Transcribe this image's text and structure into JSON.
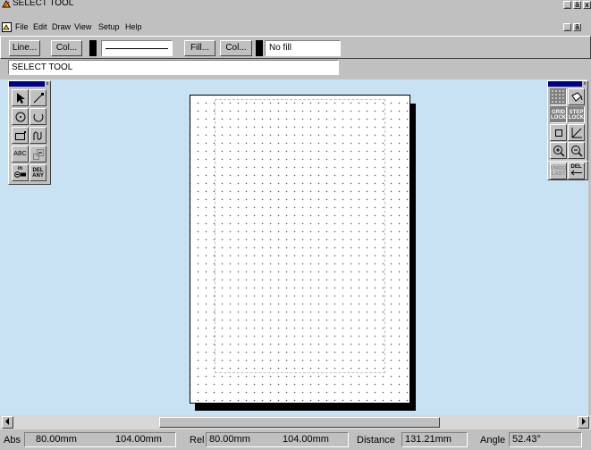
{
  "window": {
    "title": "SELECT TOOL",
    "minimize": "_",
    "restore": "ā",
    "close": "x"
  },
  "menu": {
    "items": [
      "File",
      "Edit",
      "Draw",
      "View",
      "Setup",
      "Help"
    ],
    "mdi_minimize": "_",
    "mdi_restore": "ā"
  },
  "toolbar": {
    "line_label": "Line...",
    "line_col_label": "Col...",
    "fill_label": "Fill...",
    "fill_col_label": "Col...",
    "fill_value": "No fill"
  },
  "status_field": "SELECT TOOL",
  "left_palette": {
    "close": "x",
    "text_tool": "ABC",
    "in_label": "in",
    "del_any_1": "DEL",
    "del_any_2": "ANY"
  },
  "right_palette": {
    "close": "x",
    "grid_lock_1": "GRID",
    "grid_lock_2": "LOCK",
    "step_lock_1": "STEP",
    "step_lock_2": "LOCK",
    "undo_1": "UNDO",
    "undo_2": "LAST",
    "del_label": "DEL"
  },
  "statusbar": {
    "abs_label": "Abs",
    "abs_x": "80.00mm",
    "abs_y": "104.00mm",
    "rel_label": "Rel",
    "rel_x": "80.00mm",
    "rel_y": "104.00mm",
    "distance_label": "Distance",
    "distance_value": "131.21mm",
    "angle_label": "Angle",
    "angle_value": "52.43°"
  },
  "colors": {
    "canvas": "#c8e1f3",
    "face": "#c0c0c0",
    "palette_header": "#000080"
  }
}
